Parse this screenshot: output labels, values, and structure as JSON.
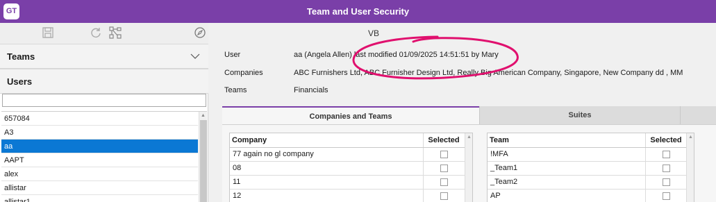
{
  "app": {
    "logo": "GT",
    "title": "Team and User Security"
  },
  "toolbar": {
    "icons": [
      "save-icon",
      "refresh-icon",
      "hierarchy-icon",
      "compass-icon"
    ]
  },
  "left": {
    "teams_header": "Teams",
    "users_header": "Users",
    "search": {
      "value": "",
      "placeholder": ""
    },
    "users": [
      "657084",
      "A3",
      "aa",
      "AAPT",
      "alex",
      "allistar",
      "allistar1"
    ],
    "selected_user": "aa"
  },
  "info": {
    "vb": "VB",
    "user_label": "User",
    "user_value": "aa (Angela Allen) last modified 01/09/2025 14:51:51 by Mary",
    "companies_label": "Companies",
    "companies_value": "ABC Furnishers Ltd, ABC Furnisher Design Ltd, Really Big American Company, Singapore, New Company dd , MM",
    "teams_label": "Teams",
    "teams_value": "Financials"
  },
  "tabs": [
    {
      "label": "Companies and Teams",
      "active": true
    },
    {
      "label": "Suites",
      "active": false
    }
  ],
  "companies_grid": {
    "headers": [
      "Company",
      "Selected"
    ],
    "rows": [
      "77 again no gl company",
      "08",
      "11",
      "12"
    ]
  },
  "teams_grid": {
    "headers": [
      "Team",
      "Selected"
    ],
    "rows": [
      "!MFA",
      "_Team1",
      "_Team2",
      "AP"
    ]
  },
  "colors": {
    "titlebar": "#7a3fa8",
    "selection": "#0b78d4",
    "annotation": "#e0106e"
  }
}
